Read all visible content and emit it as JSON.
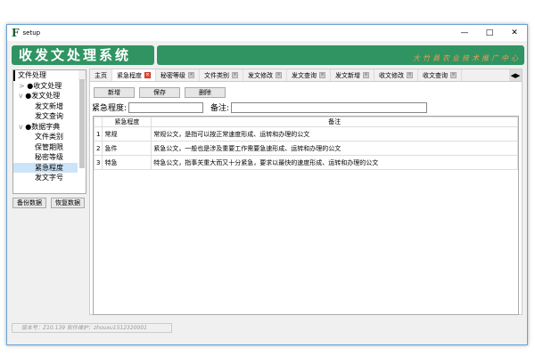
{
  "window": {
    "logo": "F",
    "title": "setup"
  },
  "banner": {
    "title": "收发文处理系统",
    "org": "大竹县农业技术推广中心"
  },
  "tree": [
    {
      "label": "文件处理",
      "lvl": 0,
      "exp": ""
    },
    {
      "label": "●收文处理",
      "lvl": 1,
      "exp": ">"
    },
    {
      "label": "●发文处理",
      "lvl": 1,
      "exp": "v"
    },
    {
      "label": "发文新增",
      "lvl": 2,
      "exp": ""
    },
    {
      "label": "发文查询",
      "lvl": 2,
      "exp": ""
    },
    {
      "label": "●数据字典",
      "lvl": 1,
      "exp": "v"
    },
    {
      "label": "文件类别",
      "lvl": 2,
      "exp": ""
    },
    {
      "label": "保管期限",
      "lvl": 2,
      "exp": ""
    },
    {
      "label": "秘密等级",
      "lvl": 2,
      "exp": ""
    },
    {
      "label": "紧急程度",
      "lvl": 2,
      "exp": "",
      "selected": true
    },
    {
      "label": "发文字号",
      "lvl": 2,
      "exp": ""
    }
  ],
  "left_buttons": {
    "backup": "备份数据",
    "restore": "恢复数据"
  },
  "tabs": [
    {
      "label": "主页",
      "closable": false
    },
    {
      "label": "紧急程度",
      "closable": true,
      "active": true
    },
    {
      "label": "秘密等级",
      "closable": true
    },
    {
      "label": "文件类别",
      "closable": true
    },
    {
      "label": "发文修改",
      "closable": true
    },
    {
      "label": "发文查询",
      "closable": true
    },
    {
      "label": "发文新增",
      "closable": true
    },
    {
      "label": "收文修改",
      "closable": true
    },
    {
      "label": "收文查询",
      "closable": true
    }
  ],
  "toolbar": {
    "add": "新增",
    "save": "保存",
    "delete": "删除"
  },
  "form": {
    "level_label": "紧急程度:",
    "level_value": "",
    "note_label": "备注:",
    "note_value": ""
  },
  "table": {
    "columns": [
      "紧急程度",
      "备注"
    ],
    "rows": [
      [
        "1",
        "常规",
        "常规公文，是指可以按正常速度形成、运转和办理的公文"
      ],
      [
        "2",
        "急件",
        "紧急公文，一般也是涉及重要工作需要急速形成、运转和办理的公文"
      ],
      [
        "3",
        "特急",
        "特急公文，指事关重大而又十分紧急，要求以最快的速度形成、运转和办理的公文"
      ]
    ]
  },
  "status": "版本号：Z10.139    软件维护：zhouxu1512320001"
}
